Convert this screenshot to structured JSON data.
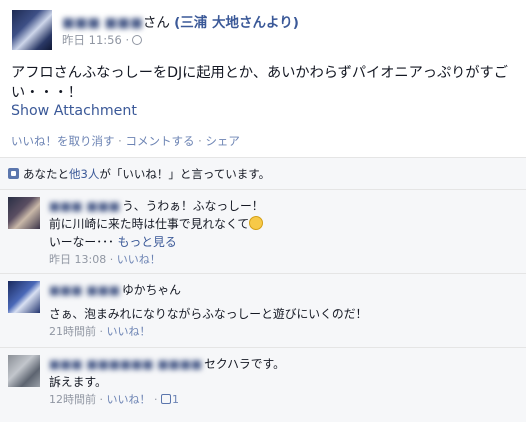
{
  "post": {
    "poster_blurred": "■■■ ■■■",
    "poster_suffix": "さん",
    "tagged": "(三浦 大地さんより)",
    "time": "昨日 11:56",
    "dot": "·",
    "text": "アフロさんふなっしーをDJに起用とか、あいかわらずパイオニアっぷりがすごい・・・！",
    "attachment_link": "Show Attachment",
    "actions": [
      "いいね！を取り消す",
      "コメントする",
      "シェア"
    ]
  },
  "likes": {
    "prefix": "あなたと",
    "others_link": "他3人",
    "suffix": "が「いいね！」と言っています。"
  },
  "comments": [
    {
      "name_blurred": "■■■ ■■■",
      "lines": [
        "う、うわぁ！ふなっしー！",
        "前に川崎に来た時は仕事で見れなくて",
        "いーなー･･･"
      ],
      "see_more": "もっと見る",
      "time": "昨日 13:08",
      "like": "いいね！"
    },
    {
      "name_blurred": "■■■ ■■■",
      "lines": [
        "ゆかちゃん",
        "さぁ、泡まみれになりながらふなっしーと遊びにいくのだ！"
      ],
      "time": "21時間前",
      "like": "いいね！"
    },
    {
      "name_blurred": "■■■ ■■■■■■ ■■■■",
      "lines": [
        "セクハラです。",
        "訴えます。"
      ],
      "time": "12時間前",
      "like": "いいね！",
      "like_count": "1"
    }
  ],
  "colors": {
    "link": "#3b5998",
    "meta": "#9197a3",
    "feedback_bg": "#f6f7f9"
  }
}
